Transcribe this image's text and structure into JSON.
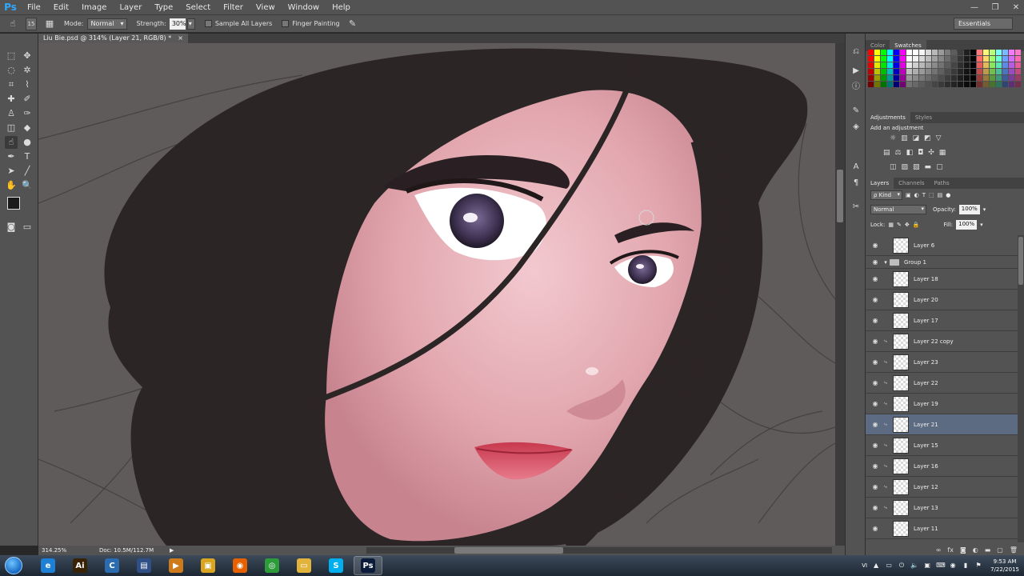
{
  "app": {
    "logo": "Ps"
  },
  "menu": [
    "File",
    "Edit",
    "Image",
    "Layer",
    "Type",
    "Select",
    "Filter",
    "View",
    "Window",
    "Help"
  ],
  "options": {
    "brush_size": "15",
    "mode_label": "Mode:",
    "mode_value": "Normal",
    "strength_label": "Strength:",
    "strength_value": "30%",
    "sample_all_layers": "Sample All Layers",
    "finger_painting": "Finger Painting",
    "workspace": "Essentials"
  },
  "document": {
    "tab_title": "Liu Bie.psd @ 314% (Layer 21, RGB/8) *",
    "close": "×"
  },
  "status": {
    "zoom": "314.25%",
    "doc_size": "Doc: 10.5M/112.7M"
  },
  "panels": {
    "color_tab": "Color",
    "swatches_tab": "Swatches",
    "adjustments_tab": "Adjustments",
    "styles_tab": "Styles",
    "add_adjustment": "Add an adjustment",
    "layers_tab": "Layers",
    "channels_tab": "Channels",
    "paths_tab": "Paths",
    "kind_filter": "ρ Kind",
    "blend_mode": "Normal",
    "opacity_label": "Opacity:",
    "opacity_value": "100%",
    "lock_label": "Lock:",
    "fill_label": "Fill:",
    "fill_value": "100%"
  },
  "layers": [
    {
      "name": "Layer 6",
      "type": "layer",
      "indent": false,
      "selected": false
    },
    {
      "name": "Group 1",
      "type": "group",
      "indent": false,
      "selected": false
    },
    {
      "name": "Layer 18",
      "type": "layer",
      "indent": false,
      "selected": false
    },
    {
      "name": "Layer 20",
      "type": "layer",
      "indent": false,
      "selected": false
    },
    {
      "name": "Layer 17",
      "type": "layer",
      "indent": false,
      "selected": false
    },
    {
      "name": "Layer 22 copy",
      "type": "layer",
      "indent": true,
      "selected": false
    },
    {
      "name": "Layer 23",
      "type": "layer",
      "indent": true,
      "selected": false
    },
    {
      "name": "Layer 22",
      "type": "layer",
      "indent": true,
      "selected": false
    },
    {
      "name": "Layer 19",
      "type": "layer",
      "indent": true,
      "selected": false
    },
    {
      "name": "Layer 21",
      "type": "layer",
      "indent": true,
      "selected": true
    },
    {
      "name": "Layer 15",
      "type": "layer",
      "indent": true,
      "selected": false
    },
    {
      "name": "Layer 16",
      "type": "layer",
      "indent": true,
      "selected": false
    },
    {
      "name": "Layer 12",
      "type": "layer",
      "indent": true,
      "selected": false
    },
    {
      "name": "Layer 13",
      "type": "layer",
      "indent": true,
      "selected": false
    },
    {
      "name": "Layer 11",
      "type": "layer",
      "indent": false,
      "selected": false
    }
  ],
  "swatch_colors": [
    "#ff0000",
    "#ffff00",
    "#00ff00",
    "#00ffff",
    "#0000ff",
    "#ff00ff",
    "#ffffff",
    "#e6e6e6",
    "#cccccc",
    "#b3b3b3",
    "#999999",
    "#808080",
    "#666666",
    "#4d4d4d",
    "#333333",
    "#1a1a1a",
    "#000000",
    "#ff6666",
    "#ffcc66",
    "#99ff66",
    "#66ffcc",
    "#6699ff",
    "#cc66ff",
    "#ff66aa"
  ],
  "taskbar": {
    "clock_time": "9:53 AM",
    "clock_date": "7/22/2015",
    "lang": "VI",
    "apps": [
      {
        "name": "ie",
        "glyph": "e",
        "color": "#1e7fd6"
      },
      {
        "name": "illustrator",
        "glyph": "Ai",
        "color": "#3a2205"
      },
      {
        "name": "ccleaner",
        "glyph": "C",
        "color": "#2b6cb0"
      },
      {
        "name": "network",
        "glyph": "▤",
        "color": "#2f4f86"
      },
      {
        "name": "media",
        "glyph": "▶",
        "color": "#cc7a1a"
      },
      {
        "name": "folder-app",
        "glyph": "▣",
        "color": "#d9a520"
      },
      {
        "name": "firefox",
        "glyph": "◉",
        "color": "#e66000"
      },
      {
        "name": "chrome",
        "glyph": "◎",
        "color": "#2e9b3a"
      },
      {
        "name": "explorer",
        "glyph": "▭",
        "color": "#e2b33b"
      },
      {
        "name": "skype",
        "glyph": "S",
        "color": "#00aff0"
      },
      {
        "name": "photoshop",
        "glyph": "Ps",
        "color": "#0b1c3a"
      }
    ]
  }
}
